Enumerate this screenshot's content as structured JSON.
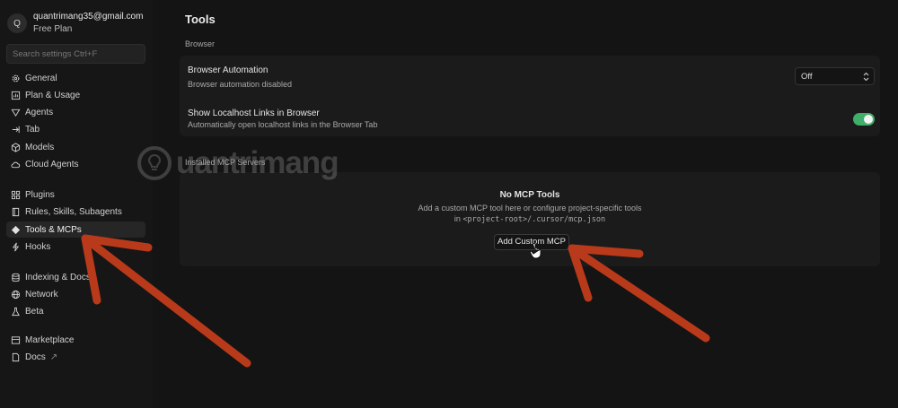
{
  "account": {
    "initial": "Q",
    "email": "quantrimang35@gmail.com",
    "plan": "Free Plan"
  },
  "search": {
    "placeholder": "Search settings Ctrl+F"
  },
  "sidebar": {
    "items": [
      {
        "label": "General",
        "icon": "gear-icon"
      },
      {
        "label": "Plan & Usage",
        "icon": "chart-icon"
      },
      {
        "label": "Agents",
        "icon": "infinity-icon"
      },
      {
        "label": "Tab",
        "icon": "tab-icon"
      },
      {
        "label": "Models",
        "icon": "cube-icon"
      },
      {
        "label": "Cloud Agents",
        "icon": "cloud-icon"
      },
      {
        "label": "Plugins",
        "icon": "grid-icon"
      },
      {
        "label": "Rules, Skills, Subagents",
        "icon": "book-icon"
      },
      {
        "label": "Tools & MCPs",
        "icon": "wrench-icon"
      },
      {
        "label": "Hooks",
        "icon": "bolt-icon"
      },
      {
        "label": "Indexing & Docs",
        "icon": "database-icon"
      },
      {
        "label": "Network",
        "icon": "globe-icon"
      },
      {
        "label": "Beta",
        "icon": "flask-icon"
      },
      {
        "label": "Marketplace",
        "icon": "store-icon"
      },
      {
        "label": "Docs",
        "icon": "doc-icon"
      }
    ],
    "docs_external": "↗"
  },
  "main": {
    "title": "Tools",
    "browser_section": "Browser",
    "browser_automation": {
      "title": "Browser Automation",
      "subtitle": "Browser automation disabled",
      "value": "Off"
    },
    "localhost_links": {
      "title": "Show Localhost Links in Browser",
      "subtitle": "Automatically open localhost links in the Browser Tab",
      "enabled": true
    },
    "mcp_section": "Installed MCP Servers",
    "mcp_empty": {
      "title": "No MCP Tools",
      "description": "Add a custom MCP tool here or configure project-specific tools",
      "path_prefix": "in",
      "path": "<project-root>/.cursor/mcp.json",
      "button": "Add Custom MCP"
    }
  },
  "watermark": {
    "text": "uantrimang"
  },
  "colors": {
    "accent_green": "#3fae6a",
    "arrow": "#b83a1a",
    "background": "#141414"
  }
}
